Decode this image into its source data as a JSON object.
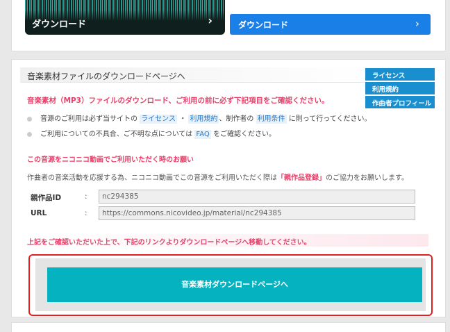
{
  "top": {
    "dark_button_label": "ダウンロード",
    "blue_button_label": "ダウンロード",
    "chevron": "›"
  },
  "section": {
    "title": "音楽素材ファイルのダウンロードページへ"
  },
  "side_nav": [
    "ライセンス",
    "利用規約",
    "作曲者プロフィール"
  ],
  "notice": {
    "title": "音楽素材（MP3）ファイルのダウンロード、ご利用の前に必ず下記項目をご確認ください。",
    "bullet1": {
      "pre": "音源のご利用は必ず当サイトの",
      "license": "ライセンス",
      "sep": "・",
      "terms": "利用規約",
      "mid": "、制作者の",
      "conditions": "利用条件",
      "post": "に則って行ってください。"
    },
    "bullet2": {
      "pre": "ご利用についての不具合、ご不明な点については",
      "faq": "FAQ",
      "post": "をご確認ください。"
    }
  },
  "nico": {
    "title": "この音源をニコニコ動画でご利用いただく時のお願い",
    "desc_pre": "作曲者の音楽活動を応援する為、ニコニコ動画でこの音源をご利用いただく際は",
    "desc_highlight": "「親作品登録」",
    "desc_post": "のご協力をお願いします。"
  },
  "fields": {
    "parent_id_label": "親作品ID",
    "parent_id_value": "nc294385",
    "url_label": "URL",
    "url_value": "https://commons.nicovideo.jp/material/nc294385",
    "colon": ":"
  },
  "confirm_text": "上記をご確認いただいた上で、下記のリンクよりダウンロードページへ移動してください。",
  "download_button_label": "音楽素材ダウンロードページへ"
}
